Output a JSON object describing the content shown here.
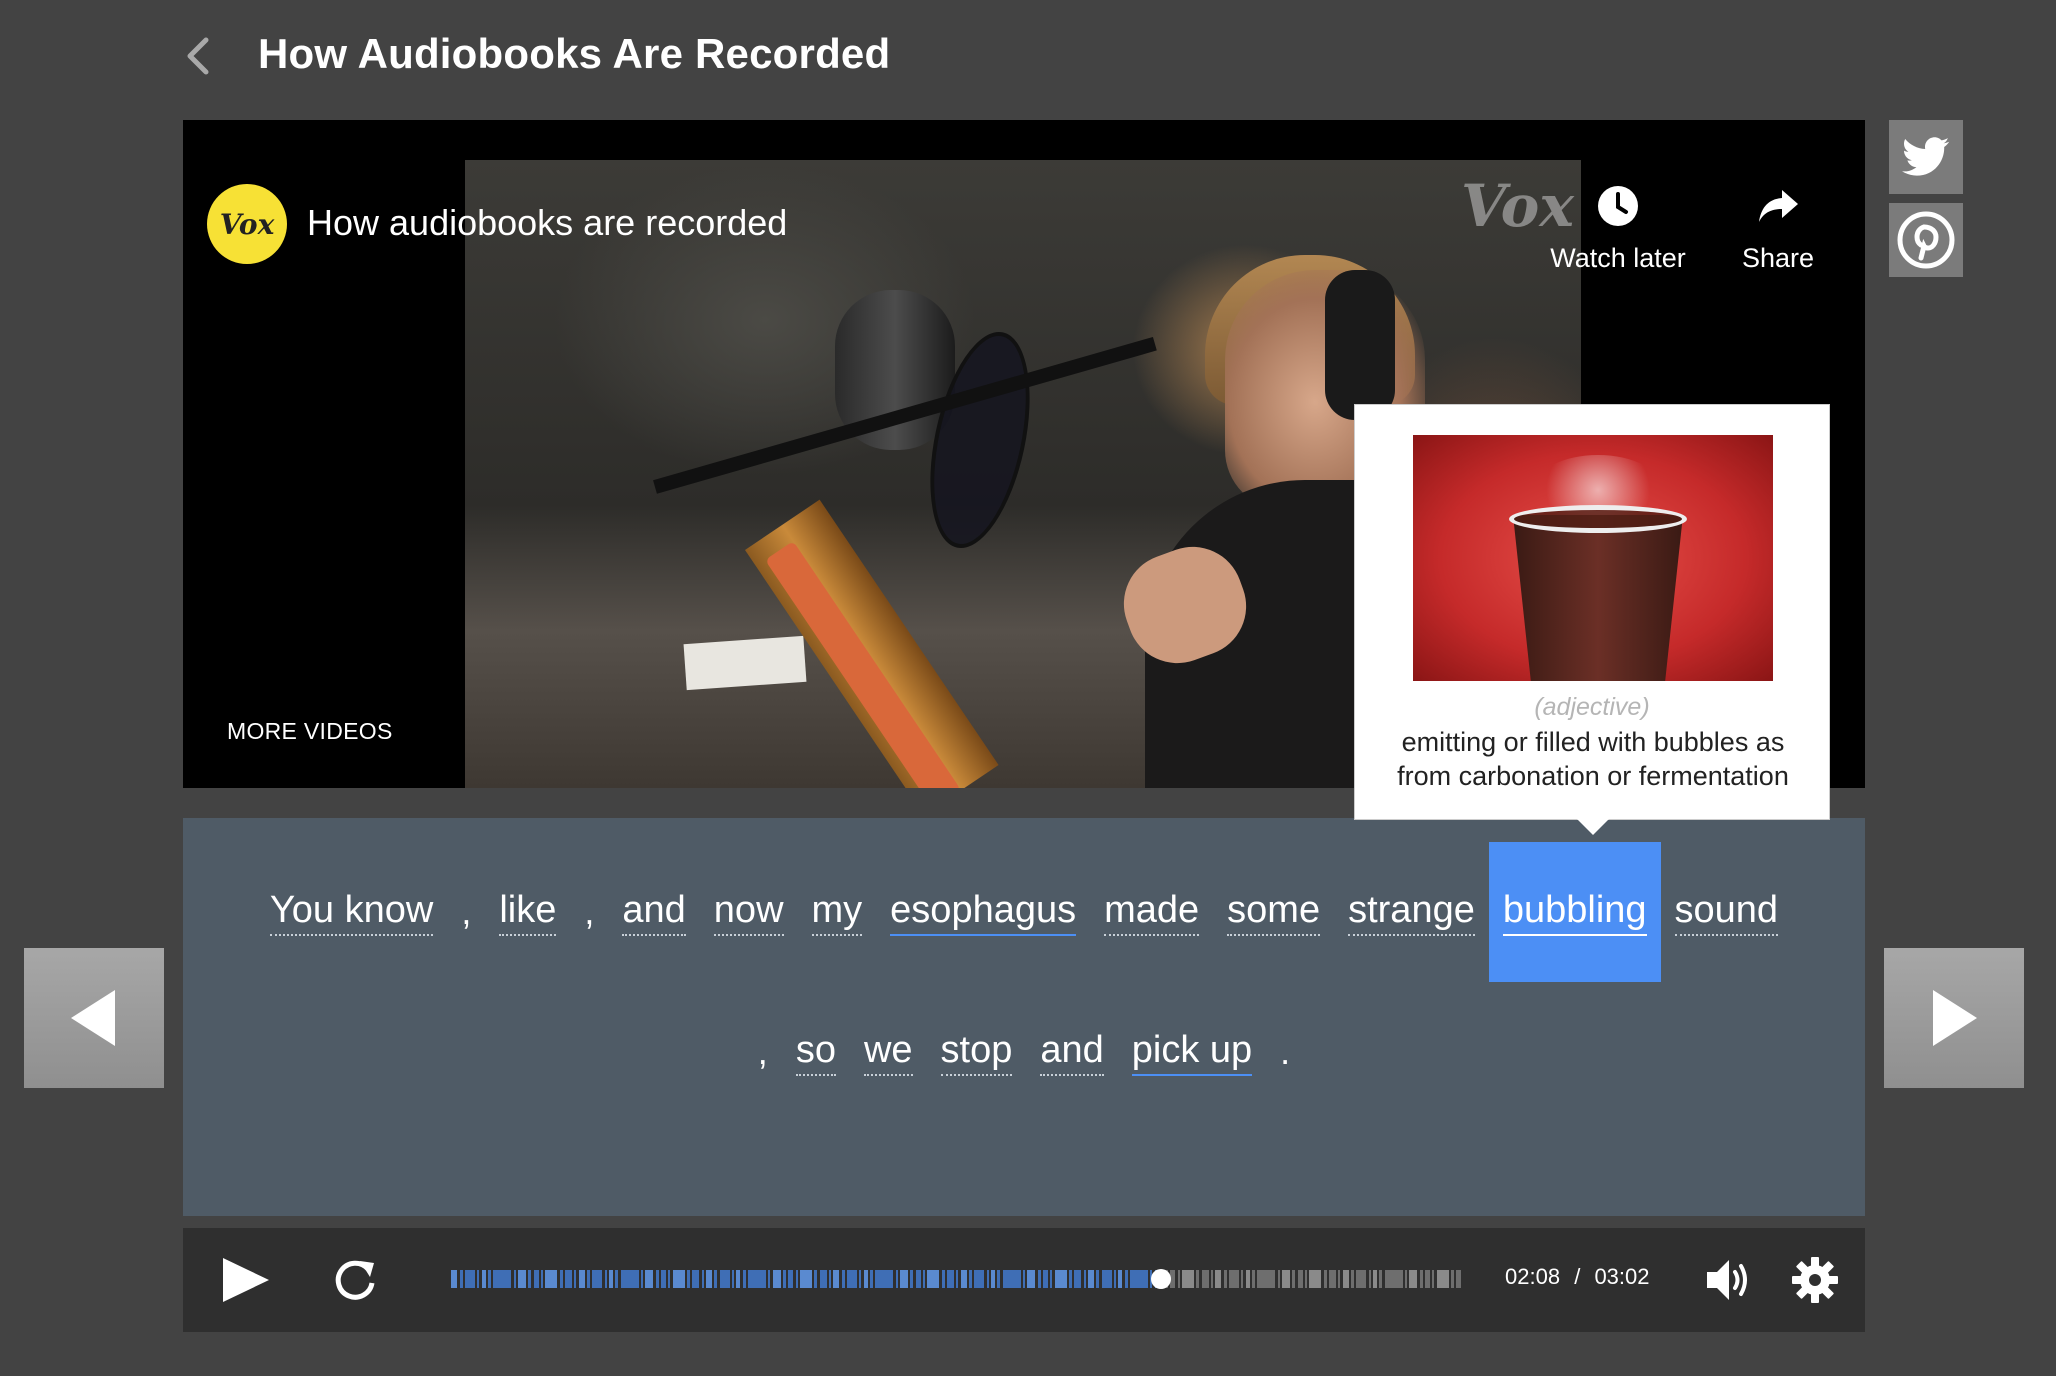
{
  "page": {
    "title": "How Audiobooks Are Recorded"
  },
  "video": {
    "title": "How audiobooks are recorded",
    "logo_text": "Vox",
    "watermark": "Vox",
    "watch_later_label": "Watch later",
    "share_label": "Share",
    "more_videos_label": "MORE VIDEOS"
  },
  "transcript": {
    "line1": [
      {
        "text": "You know",
        "type": "word"
      },
      {
        "text": ",",
        "type": "punct"
      },
      {
        "text": "like",
        "type": "word"
      },
      {
        "text": ",",
        "type": "punct"
      },
      {
        "text": "and",
        "type": "word"
      },
      {
        "text": "now",
        "type": "word"
      },
      {
        "text": "my",
        "type": "word"
      },
      {
        "text": "esophagus",
        "type": "vocab"
      },
      {
        "text": "made",
        "type": "word"
      },
      {
        "text": "some",
        "type": "word"
      },
      {
        "text": "strange",
        "type": "word"
      },
      {
        "text": "bubbling",
        "type": "active"
      },
      {
        "text": "sound",
        "type": "word"
      }
    ],
    "line2": [
      {
        "text": ",",
        "type": "punct"
      },
      {
        "text": "so",
        "type": "word"
      },
      {
        "text": "we",
        "type": "word"
      },
      {
        "text": "stop",
        "type": "word"
      },
      {
        "text": "and",
        "type": "word"
      },
      {
        "text": "pick up",
        "type": "vocab"
      },
      {
        "text": ".",
        "type": "punct"
      }
    ]
  },
  "tooltip": {
    "part_of_speech": "(adjective)",
    "definition": "emitting or filled with bubbles as from carbonation or fermentation"
  },
  "player": {
    "current_time": "02:08",
    "separator": "/",
    "duration": "03:02",
    "progress_fraction": 0.703
  },
  "colors": {
    "background": "#434343",
    "transcript_bg": "#4f5b66",
    "accent": "#4c8ff5",
    "vox_yellow": "#f7e135"
  },
  "icons": {
    "back": "chevron-left-icon",
    "twitter": "twitter-icon",
    "pinterest": "pinterest-icon",
    "watch_later": "clock-icon",
    "share": "share-arrow-icon",
    "play": "play-icon",
    "replay": "replay-icon",
    "volume": "volume-icon",
    "settings": "gear-icon"
  }
}
